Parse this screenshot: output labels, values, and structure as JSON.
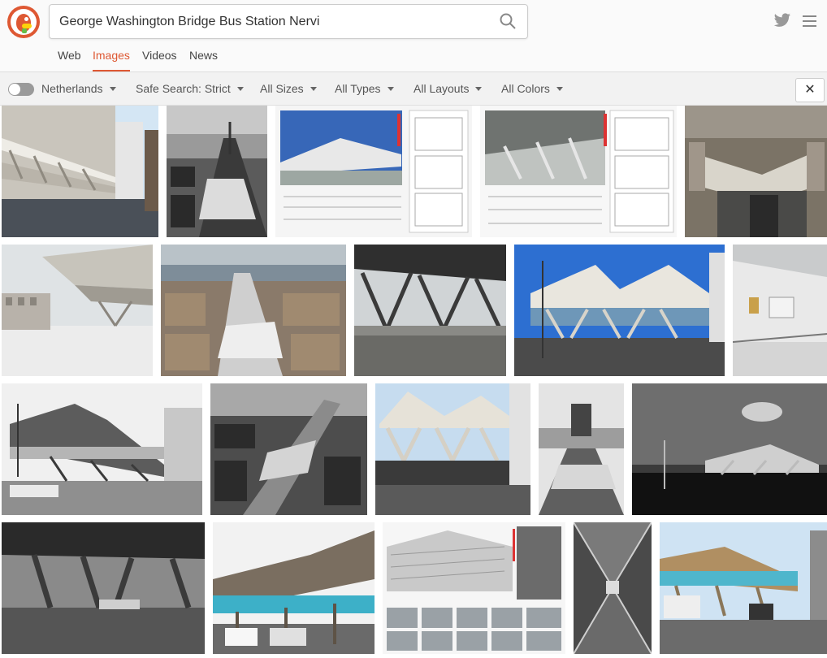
{
  "search": {
    "query": "George Washington Bridge Bus Station Nervi"
  },
  "tabs": [
    {
      "label": "Web",
      "active": false
    },
    {
      "label": "Images",
      "active": true
    },
    {
      "label": "Videos",
      "active": false
    },
    {
      "label": "News",
      "active": false
    }
  ],
  "filters": {
    "region": "Netherlands",
    "safe_search": "Safe Search: Strict",
    "size": "All Sizes",
    "type": "All Types",
    "layout": "All Layouts",
    "color": "All Colors",
    "close_label": "✕"
  },
  "results": [
    {
      "name": "image-result-1",
      "style": "street-canopy-color"
    },
    {
      "name": "image-result-2",
      "style": "aerial-bw"
    },
    {
      "name": "image-result-3",
      "style": "architect-sheet"
    },
    {
      "name": "image-result-4",
      "style": "architect-sheet-interior"
    },
    {
      "name": "image-result-5",
      "style": "aerial-color"
    },
    {
      "name": "image-result-6",
      "style": "canopy-underside-pale"
    },
    {
      "name": "image-result-7",
      "style": "aerial-bridge-color"
    },
    {
      "name": "image-result-8",
      "style": "interior-trusses"
    },
    {
      "name": "image-result-9",
      "style": "blue-sky-station"
    },
    {
      "name": "image-result-10",
      "style": "under-canopy-light"
    },
    {
      "name": "image-result-11",
      "style": "bw-street-station"
    },
    {
      "name": "image-result-12",
      "style": "aerial-bw-2"
    },
    {
      "name": "image-result-13",
      "style": "canopy-front-color"
    },
    {
      "name": "image-result-14",
      "style": "bw-bridge-view"
    },
    {
      "name": "image-result-15",
      "style": "bw-dramatic-sky"
    },
    {
      "name": "image-result-16",
      "style": "bw-interior"
    },
    {
      "name": "image-result-17",
      "style": "cyan-facade"
    },
    {
      "name": "image-result-18",
      "style": "model-sheet"
    },
    {
      "name": "image-result-19",
      "style": "bw-concrete-detail"
    },
    {
      "name": "image-result-20",
      "style": "street-cyan-facade"
    }
  ]
}
